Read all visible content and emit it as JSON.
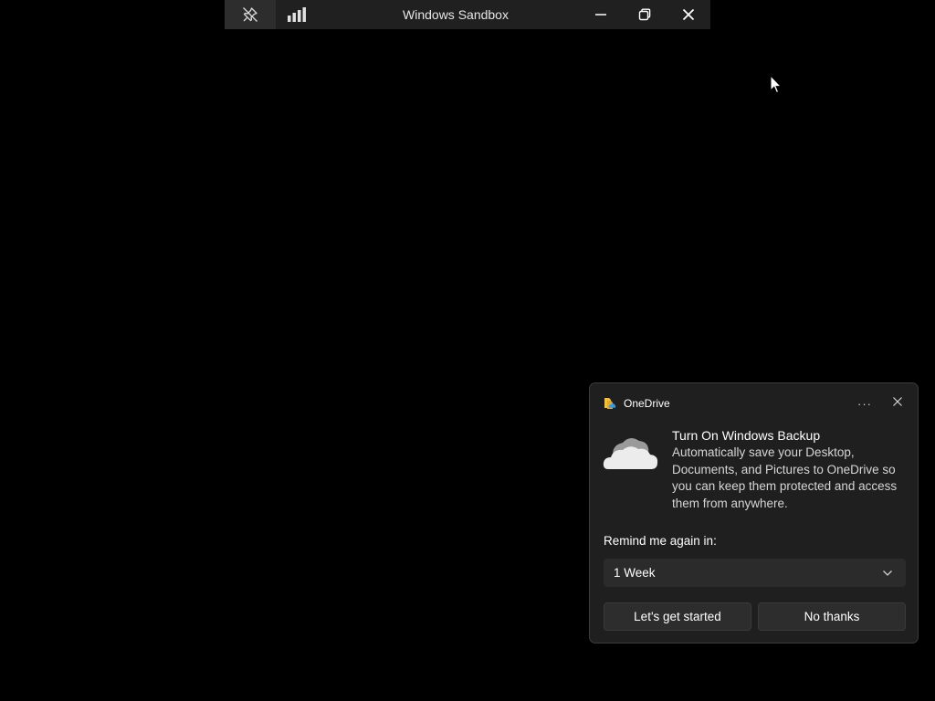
{
  "sandbox_bar": {
    "title": "Windows Sandbox",
    "pin_icon": "unpin-icon",
    "signal_icon": "connection-bars-icon",
    "minimize_icon": "minimize-icon",
    "restore_icon": "restore-icon",
    "close_icon": "close-icon"
  },
  "toast": {
    "app_name": "OneDrive",
    "app_icon": "onedrive-app-icon",
    "more_label": "···",
    "hero_icon": "onedrive-cloud-icon",
    "title": "Turn On Windows Backup",
    "description": "Automatically save your Desktop, Documents, and Pictures to OneDrive so you can keep them protected and access them from anywhere.",
    "remind_label": "Remind me again in:",
    "remind_select": {
      "selected": "1 Week"
    },
    "primary_button": "Let's get started",
    "secondary_button": "No thanks"
  },
  "colors": {
    "desktop_background": "#000000",
    "bar_background": "#202020",
    "toast_background": "#1f1f1f",
    "button_background": "#2d2d2d"
  }
}
